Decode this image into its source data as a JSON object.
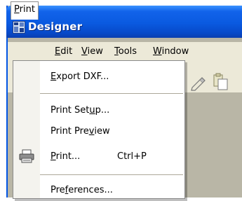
{
  "window": {
    "title": "Designer"
  },
  "menubar": {
    "items": [
      {
        "label": "Print",
        "mnemonic_index": 0
      },
      {
        "label": "Edit",
        "mnemonic_index": 0
      },
      {
        "label": "View",
        "mnemonic_index": 0
      },
      {
        "label": "Tools",
        "mnemonic_index": 0
      },
      {
        "label": "Window",
        "mnemonic_index": 0
      }
    ],
    "active": "Print"
  },
  "dropdown": {
    "items": [
      {
        "label": "Export DXF...",
        "mnemonic": "E",
        "shortcut": ""
      },
      {
        "label": "Print Setup...",
        "mnemonic": "u",
        "shortcut": ""
      },
      {
        "label": "Print Preview",
        "mnemonic": "v",
        "shortcut": ""
      },
      {
        "label": "Print...",
        "mnemonic": "P",
        "shortcut": "Ctrl+P",
        "icon": "printer-icon"
      },
      {
        "label": "Preferences...",
        "mnemonic": "f",
        "shortcut": ""
      }
    ]
  },
  "colors": {
    "titlebar": "#0a5ae0",
    "menubar": "#ece9d8",
    "workspace": "#b9b6a6",
    "menu_background": "#ffffff"
  }
}
